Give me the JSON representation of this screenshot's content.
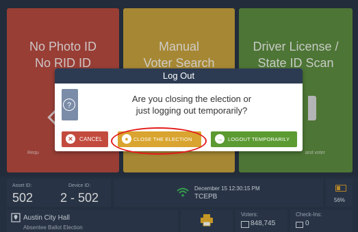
{
  "tiles": {
    "no_photo": {
      "line1": "No Photo ID",
      "line2": "No RID ID",
      "sub": "Requ"
    },
    "manual": {
      "line1": "Manual",
      "line2": "Voter Search"
    },
    "license": {
      "line1": "Driver License /",
      "line2": "State ID Scan",
      "sub": "and voter"
    }
  },
  "modal": {
    "title": "Log Out",
    "message_line1": "Are you closing the election or",
    "message_line2": "just logging out temporarily?",
    "cancel_label": "CANCEL",
    "close_label": "CLOSE THE ELECTION",
    "logout_label": "LOGOUT TEMPORARILY"
  },
  "status": {
    "asset_label": "Asset ID:",
    "asset_value": "502",
    "device_label": "Device ID:",
    "device_value": "2 - 502",
    "datetime": "December 15  12:30:15 PM",
    "network": "TCEPB",
    "battery": "56%",
    "location": "Austin City Hall",
    "location_sub": "Absentee Ballot Election",
    "voters_label": "Voters:",
    "voters_value": "848,745",
    "checkins_label": "Check-Ins:",
    "checkins_value": "0"
  },
  "icons": {
    "help": "question-circle-icon",
    "cancel": "x-circle-icon",
    "close": "lock-icon",
    "logout": "logout-icon",
    "wifi": "wifi-icon",
    "battery": "battery-icon",
    "location": "map-pin-icon",
    "printer": "printer-icon"
  },
  "colors": {
    "red_tile": "#b8493c",
    "yellow_tile": "#c9a13a",
    "green_tile": "#5c8b3c",
    "modal_header": "#2c3b52",
    "highlight_ring": "#e31b1b"
  }
}
